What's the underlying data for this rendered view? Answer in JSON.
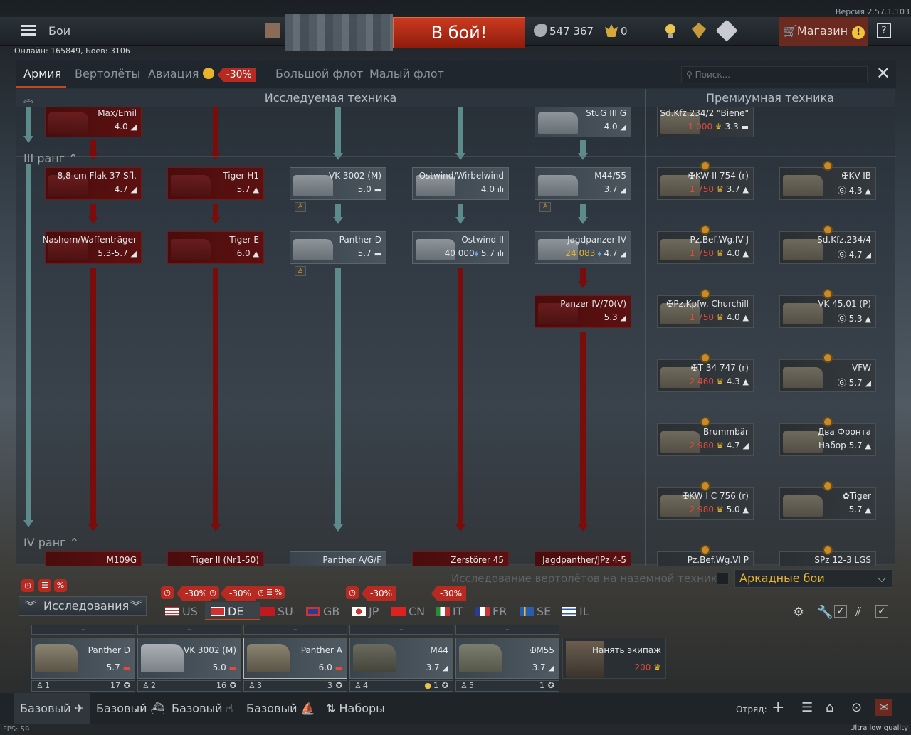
{
  "version": "Версия 2.57.1.103",
  "topbar": {
    "title": "Бои",
    "fight_button": "В бой!",
    "silver_lions": "547 367",
    "golden_eagles": "0",
    "shop_label": "Магазин",
    "shop_alert": "!",
    "help": "?"
  },
  "online": "Онлайн: 165849, Боёв: 3106",
  "tabs": [
    {
      "label": "Армия"
    },
    {
      "label": "Вертолёты"
    },
    {
      "label": "Авиация"
    },
    {
      "label": "Большой флот"
    },
    {
      "label": "Малый флот"
    }
  ],
  "aviation_discount": "-30%",
  "search_placeholder": "Поиск...",
  "sections": {
    "research": "Исследуемая техника",
    "premium": "Премиумная техника"
  },
  "ranks": {
    "r3": "III ранг",
    "r4": "IV ранг"
  },
  "tree": {
    "c1r0": {
      "name": "Max/Emil",
      "br": "4.0"
    },
    "c4r0": {
      "name": "StuG III G",
      "br": "4.0"
    },
    "p1r0": {
      "name": "Sd.Kfz.234/2 \"Biene\"",
      "cost": "1 000",
      "br": "3.3"
    },
    "c1r1": {
      "name": "8,8 cm Flak 37 Sfl.",
      "br": "4.7"
    },
    "c2r1": {
      "name": "Tiger H1",
      "br": "5.7"
    },
    "c3r1": {
      "name": "VK 3002 (M)",
      "br": "5.0"
    },
    "c4r1": {
      "name": "Ostwind/Wirbelwind",
      "br": "4.0"
    },
    "c5r1": {
      "name": "M44/55",
      "br": "3.7"
    },
    "c1r2": {
      "name": "Nashorn/Waffenträger",
      "br": "5.3-5.7"
    },
    "c2r2": {
      "name": "Tiger E",
      "br": "6.0"
    },
    "c3r2": {
      "name": "Panther D",
      "br": "5.7"
    },
    "c4r2": {
      "name": "Ostwind II",
      "cost": "40 000",
      "br": "5.7"
    },
    "c5r2": {
      "name": "Jagdpanzer IV",
      "cost": "24 083",
      "br": "4.7"
    },
    "c5r3": {
      "name": "Panzer IV/70(V)",
      "br": "5.3"
    },
    "c1r4": {
      "name": "M109G"
    },
    "c2r4": {
      "name": "Tiger II (Nr1-50)"
    },
    "c3r4": {
      "name": "Panther A/G/F"
    },
    "c4r4": {
      "name": "Zerstörer 45"
    },
    "c5r4": {
      "name": "Jagdpanther/JPz 4-5"
    },
    "prem": [
      {
        "name": "✠KW II 754 (r)",
        "cost": "1 750",
        "br": "3.7"
      },
      {
        "name": "✠KV-IB",
        "br": "4.3"
      },
      {
        "name": "Pz.Bef.Wg.IV J",
        "cost": "1 750",
        "br": "4.0"
      },
      {
        "name": "Sd.Kfz.234/4",
        "br": "4.7"
      },
      {
        "name": "✠Pz.Kpfw. Churchill",
        "cost": "1 750",
        "br": "4.0"
      },
      {
        "name": "VK 45.01 (P)",
        "br": "5.3"
      },
      {
        "name": "✠T 34 747 (r)",
        "cost": "2 460",
        "br": "4.3"
      },
      {
        "name": "VFW",
        "br": "5.7"
      },
      {
        "name": "Brummbär",
        "cost": "2 980",
        "br": "4.7"
      },
      {
        "name": "Два Фронта",
        "sub": "Набор",
        "br": "5.7"
      },
      {
        "name": "✠KW I C 756 (r)",
        "cost": "2 980",
        "br": "5.0"
      },
      {
        "name": "✿Tiger",
        "br": "5.7"
      },
      {
        "name": "Pz.Bef.Wg.VI P"
      },
      {
        "name": "SPz 12-3 LGS"
      }
    ]
  },
  "heli_research_label": "Исследование вертолётов на наземной технике",
  "game_mode": "Аркадные бои",
  "research_button": "Исследования",
  "nations": [
    {
      "code": "US"
    },
    {
      "code": "DE"
    },
    {
      "code": "SU"
    },
    {
      "code": "GB"
    },
    {
      "code": "JP"
    },
    {
      "code": "CN"
    },
    {
      "code": "IT"
    },
    {
      "code": "FR"
    },
    {
      "code": "SE"
    },
    {
      "code": "IL"
    }
  ],
  "nation_discounts": [
    "-30%",
    "-30%",
    "-30%",
    "-30%"
  ],
  "crew": [
    {
      "top": "–",
      "name": "Panther D",
      "br": "5.7",
      "slot": "1",
      "level": "17"
    },
    {
      "top": "–",
      "name": "VK 3002 (M)",
      "br": "5.0",
      "slot": "2",
      "level": "16"
    },
    {
      "top": "–",
      "name": "Panther A",
      "br": "6.0",
      "slot": "3",
      "level": "3"
    },
    {
      "top": "–",
      "name": "M44",
      "br": "3.7",
      "slot": "4",
      "level": "1"
    },
    {
      "top": "–",
      "name": "✠M55",
      "br": "3.7",
      "slot": "5",
      "level": "1"
    }
  ],
  "hire": {
    "label": "Нанять экипаж",
    "cost": "200"
  },
  "bottom": {
    "b1": "Базовый",
    "b2": "Базовый",
    "b3": "Базовый",
    "b4": "Базовый",
    "sets": "Наборы",
    "squad": "Отряд:"
  },
  "fps": "FPS: 59",
  "quality": "Ultra low quality"
}
